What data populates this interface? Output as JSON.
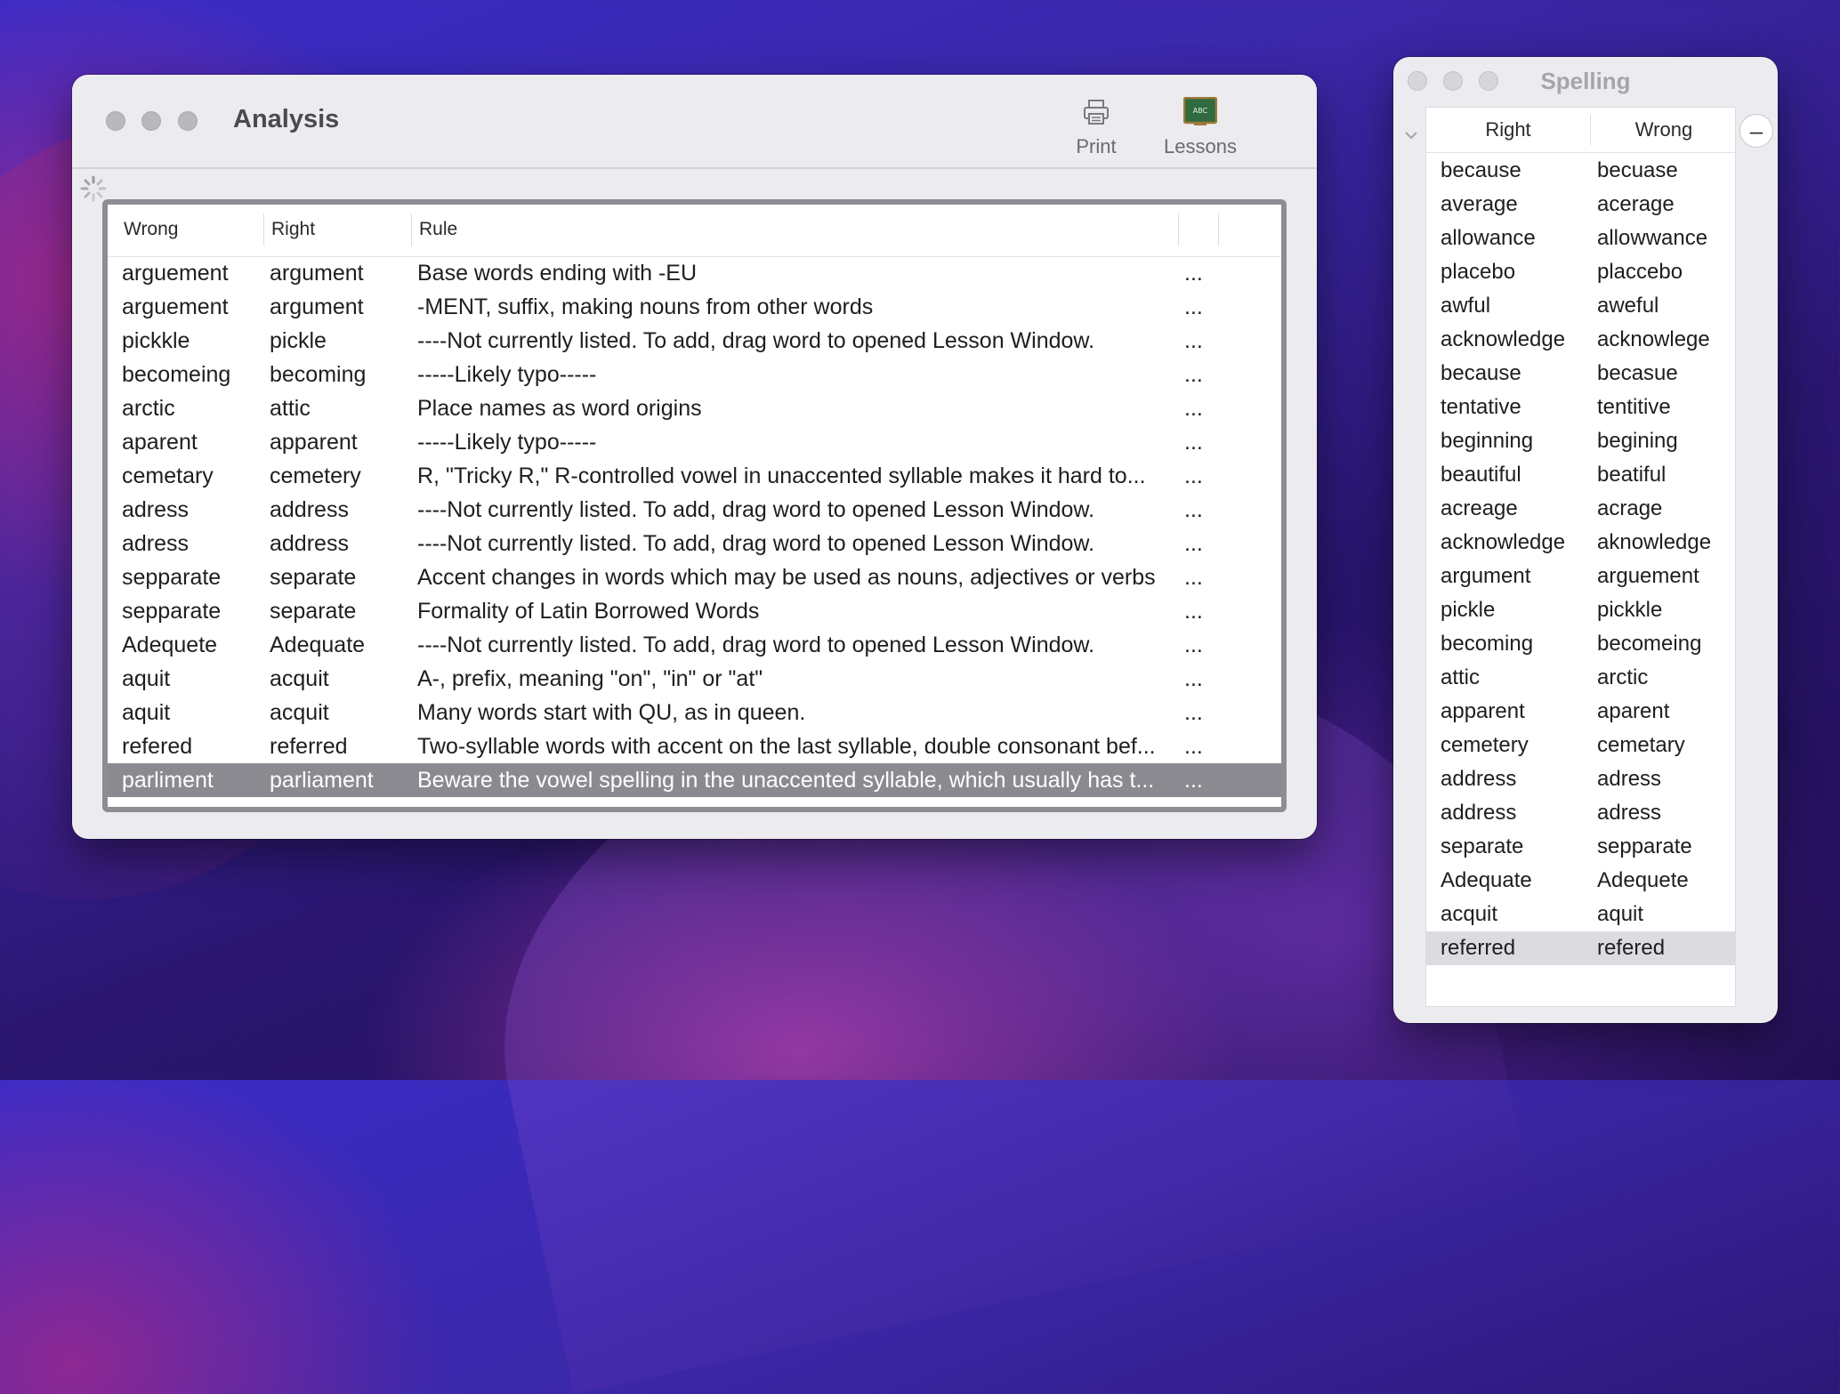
{
  "analysis": {
    "title": "Analysis",
    "toolbar": {
      "print_label": "Print",
      "lessons_label": "Lessons",
      "lessons_icon_text": "ABC"
    },
    "columns": {
      "wrong": "Wrong",
      "right": "Right",
      "rule": "Rule"
    },
    "rows": [
      {
        "wrong": "arguement",
        "right": "argument",
        "rule": "Base words ending with -EU",
        "more": "..."
      },
      {
        "wrong": "arguement",
        "right": "argument",
        "rule": "-MENT, suffix, making nouns from other words",
        "more": "..."
      },
      {
        "wrong": "pickkle",
        "right": "pickle",
        "rule": "----Not currently listed. To add, drag word to opened Lesson Window.",
        "more": "..."
      },
      {
        "wrong": "becomeing",
        "right": "becoming",
        "rule": "-----Likely typo-----",
        "more": "..."
      },
      {
        "wrong": "arctic",
        "right": "attic",
        "rule": "Place names as word origins",
        "more": "..."
      },
      {
        "wrong": "aparent",
        "right": "apparent",
        "rule": "-----Likely typo-----",
        "more": "..."
      },
      {
        "wrong": "cemetary",
        "right": "cemetery",
        "rule": "R, \"Tricky R,\" R-controlled vowel in unaccented syllable makes it hard to...",
        "more": "..."
      },
      {
        "wrong": "adress",
        "right": "address",
        "rule": "----Not currently listed. To add, drag word to opened Lesson Window.",
        "more": "..."
      },
      {
        "wrong": "adress",
        "right": "address",
        "rule": "----Not currently listed. To add, drag word to opened Lesson Window.",
        "more": "..."
      },
      {
        "wrong": "sepparate",
        "right": "separate",
        "rule": "Accent changes in words which may be used as nouns, adjectives or verbs",
        "more": "..."
      },
      {
        "wrong": "sepparate",
        "right": "separate",
        "rule": "Formality of Latin Borrowed Words",
        "more": "..."
      },
      {
        "wrong": "Adequete",
        "right": "Adequate",
        "rule": "----Not currently listed. To add, drag word to opened Lesson Window.",
        "more": "..."
      },
      {
        "wrong": "aquit",
        "right": "acquit",
        "rule": "A-, prefix, meaning \"on\", \"in\" or \"at\"",
        "more": "..."
      },
      {
        "wrong": "aquit",
        "right": "acquit",
        "rule": "Many words start with QU, as in queen.",
        "more": "..."
      },
      {
        "wrong": "refered",
        "right": "referred",
        "rule": "Two-syllable words with accent on the last syllable, double consonant bef...",
        "more": "..."
      },
      {
        "wrong": "parliment",
        "right": "parliament",
        "rule": "Beware the vowel spelling in the unaccented syllable, which usually has t...",
        "more": "..."
      }
    ]
  },
  "spelling": {
    "title": "Spelling",
    "columns": {
      "right": "Right",
      "wrong": "Wrong"
    },
    "minus_label": "–",
    "rows": [
      {
        "right": "because",
        "wrong": "becuase"
      },
      {
        "right": "average",
        "wrong": "acerage"
      },
      {
        "right": "allowance",
        "wrong": "allowwance"
      },
      {
        "right": "placebo",
        "wrong": "placcebo"
      },
      {
        "right": "awful",
        "wrong": "aweful"
      },
      {
        "right": "acknowledge",
        "wrong": "acknowlege"
      },
      {
        "right": "because",
        "wrong": "becasue"
      },
      {
        "right": "tentative",
        "wrong": "tentitive"
      },
      {
        "right": "beginning",
        "wrong": "begining"
      },
      {
        "right": "beautiful",
        "wrong": "beatiful"
      },
      {
        "right": "acreage",
        "wrong": "acrage"
      },
      {
        "right": "acknowledge",
        "wrong": "aknowledge"
      },
      {
        "right": "argument",
        "wrong": "arguement"
      },
      {
        "right": "pickle",
        "wrong": "pickkle"
      },
      {
        "right": "becoming",
        "wrong": "becomeing"
      },
      {
        "right": "attic",
        "wrong": "arctic"
      },
      {
        "right": "apparent",
        "wrong": "aparent"
      },
      {
        "right": "cemetery",
        "wrong": "cemetary"
      },
      {
        "right": "address",
        "wrong": "adress"
      },
      {
        "right": "address",
        "wrong": "adress"
      },
      {
        "right": "separate",
        "wrong": "sepparate"
      },
      {
        "right": "Adequate",
        "wrong": "Adequete"
      },
      {
        "right": "acquit",
        "wrong": "aquit"
      },
      {
        "right": "referred",
        "wrong": "refered"
      }
    ]
  }
}
